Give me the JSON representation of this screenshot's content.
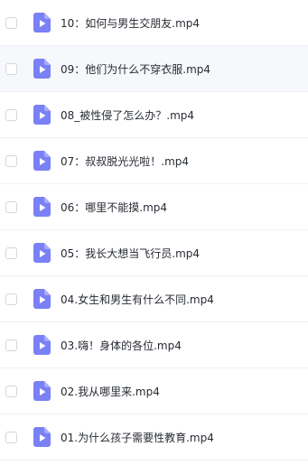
{
  "file_list": {
    "icon_color": "#7a80f5",
    "icon_color_light": "#a6abfb",
    "items": [
      {
        "name": "10：如何与男生交朋友.mp4",
        "icon": "video-file-icon"
      },
      {
        "name": "09：他们为什么不穿衣服.mp4",
        "icon": "video-file-icon"
      },
      {
        "name": "08_被性侵了怎么办？.mp4",
        "icon": "video-file-icon"
      },
      {
        "name": "07：叔叔脱光光啦！.mp4",
        "icon": "video-file-icon"
      },
      {
        "name": "06：哪里不能摸.mp4",
        "icon": "video-file-icon"
      },
      {
        "name": "05：我长大想当飞行员.mp4",
        "icon": "video-file-icon"
      },
      {
        "name": "04.女生和男生有什么不同.mp4",
        "icon": "video-file-icon"
      },
      {
        "name": "03.嗨！身体的各位.mp4",
        "icon": "video-file-icon"
      },
      {
        "name": "02.我从哪里来.mp4",
        "icon": "video-file-icon"
      },
      {
        "name": "01.为什么孩子需要性教育.mp4",
        "icon": "video-file-icon"
      }
    ]
  }
}
